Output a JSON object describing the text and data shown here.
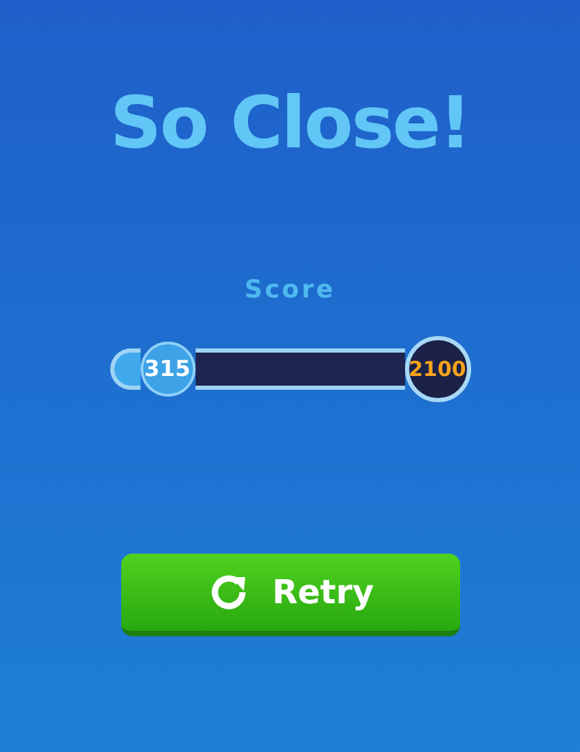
{
  "title": "So Close!",
  "score": {
    "label": "Score",
    "value": "315",
    "target": "2100"
  },
  "buttons": [
    {
      "label": "Retry",
      "kind": "retry"
    }
  ]
}
